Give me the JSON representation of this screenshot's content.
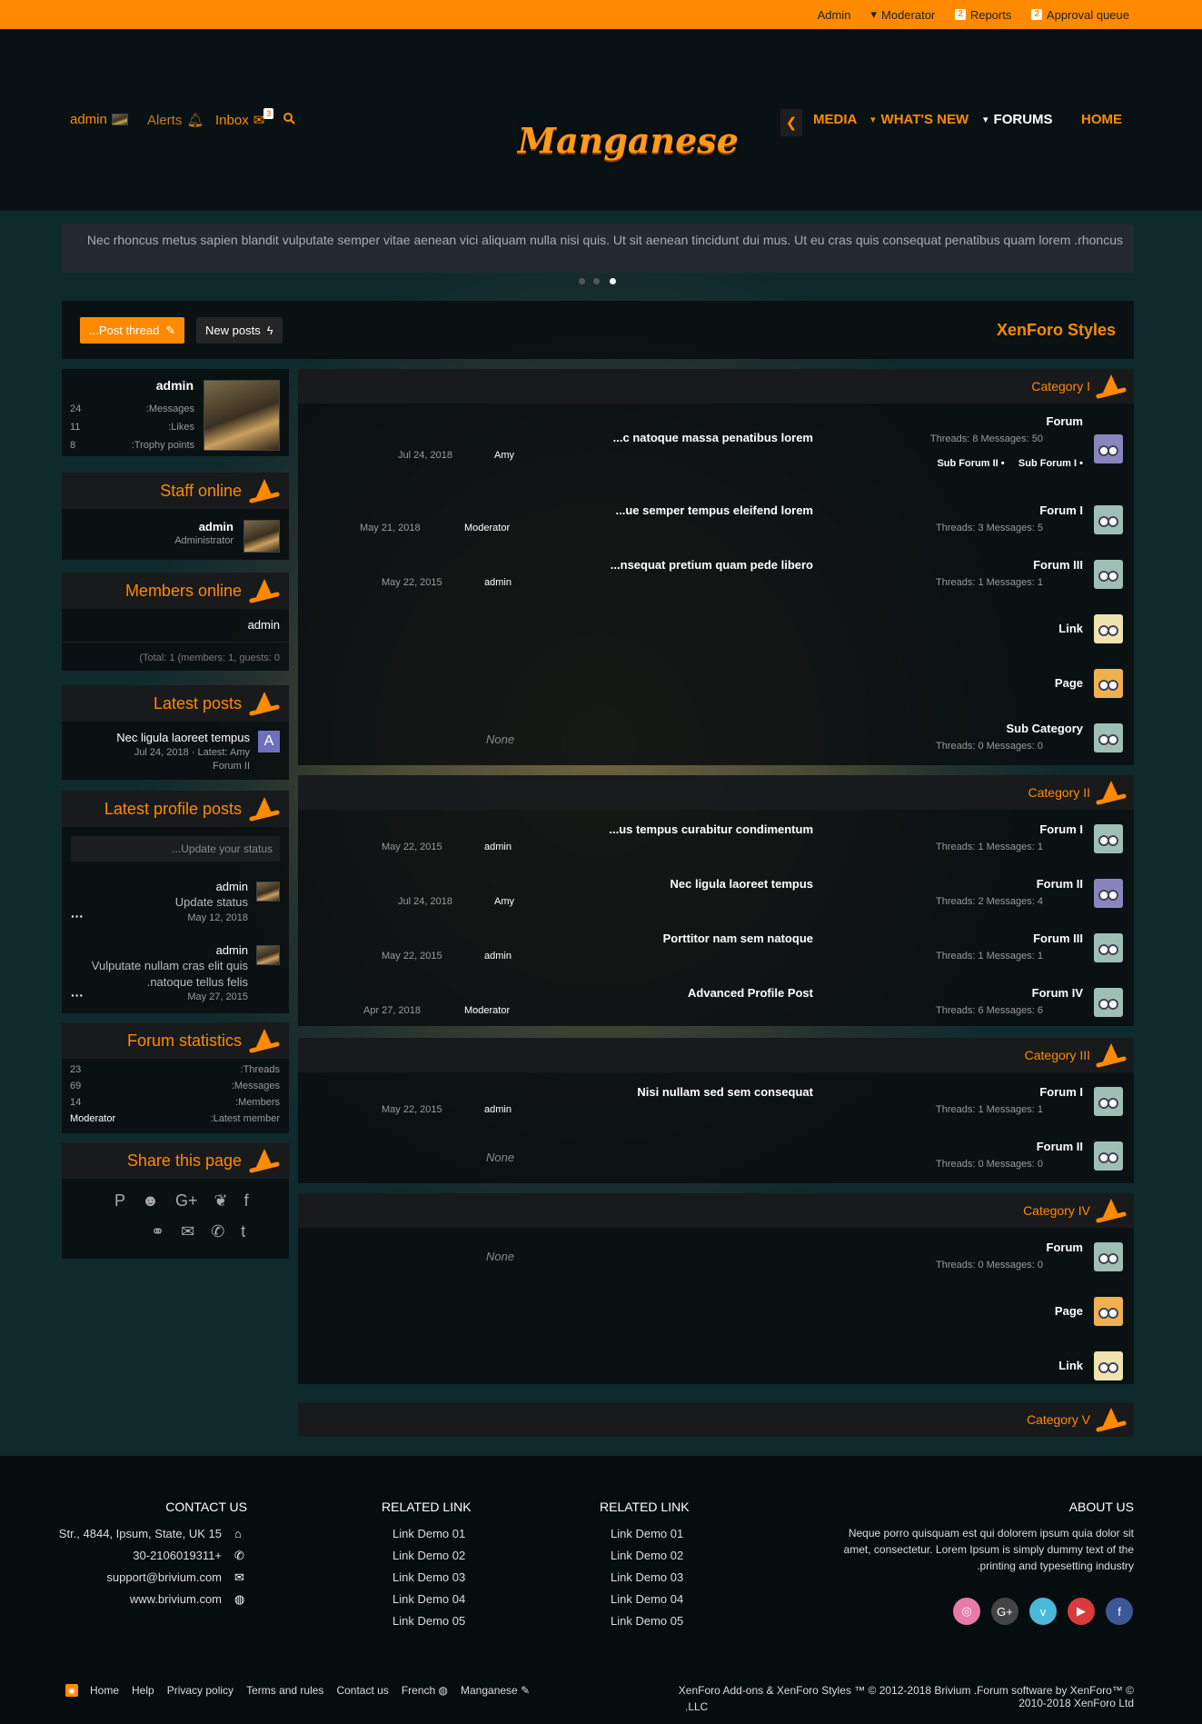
{
  "staff_bar": {
    "admin": "Admin",
    "moderator": "Moderator",
    "reports_count": "2",
    "reports": "Reports",
    "approval_count": "2",
    "approval": "Approval queue"
  },
  "header": {
    "user": "admin",
    "alerts": "Alerts",
    "inbox": "Inbox",
    "inbox_count": "3",
    "logo": "Manganese",
    "nav": {
      "media": "MEDIA",
      "whats_new": "WHAT'S NEW",
      "forums": "FORUMS",
      "home": "HOME"
    }
  },
  "notice": "Nec rhoncus metus sapien blandit vulputate semper vitae aenean vici aliquam nulla nisi quis. Ut sit aenean tincidunt dui mus. Ut eu cras quis consequat penatibus quam lorem .rhoncus",
  "actions": {
    "post_thread": "...Post thread",
    "new_posts": "New posts",
    "site_title": "XenForo Styles"
  },
  "sidebar": {
    "visitor": {
      "name": "admin",
      "stats": [
        {
          "value": "24",
          "label": ":Messages"
        },
        {
          "value": "11",
          "label": ":Likes"
        },
        {
          "value": "8",
          "label": ":Trophy points"
        }
      ]
    },
    "staff_online": {
      "title": "Staff online",
      "name": "admin",
      "role": "Administrator"
    },
    "members_online": {
      "title": "Members online",
      "name": "admin",
      "total": "(Total: 1 (members: 1, guests: 0"
    },
    "latest_posts": {
      "title": "Latest posts",
      "post_title": "Nec ligula laoreet tempus",
      "meta": "Jul 24, 2018 · Latest: Amy",
      "forum": "Forum II",
      "avatar_letter": "A"
    },
    "profile_posts": {
      "title": "Latest profile posts",
      "placeholder": "...Update your status",
      "items": [
        {
          "name": "admin",
          "text": "Update status",
          "date": "May 12, 2018"
        },
        {
          "name": "admin",
          "text": "Vulputate nullam cras elit quis",
          "text2": ".natoque tellus felis",
          "date": "May 27, 2015"
        }
      ]
    },
    "statistics": {
      "title": "Forum statistics",
      "rows": [
        {
          "value": "23",
          "label": ":Threads"
        },
        {
          "value": "69",
          "label": ":Messages"
        },
        {
          "value": "14",
          "label": ":Members"
        },
        {
          "value": "Moderator",
          "label": ":Latest member"
        }
      ]
    },
    "share": {
      "title": "Share this page"
    }
  },
  "categories": [
    {
      "title": "Category I",
      "empty": "None",
      "forums": [
        {
          "name": "Forum",
          "stats": "Threads: 8 Messages: 50",
          "sub1": "Sub Forum II",
          "sub2": "Sub Forum I",
          "latest": "...c natoque massa penatibus lorem",
          "date": "Jul 24, 2018",
          "user": "Amy"
        },
        {
          "name": "Forum I",
          "stats": "Threads: 3 Messages: 5",
          "latest": "...ue semper tempus eleifend lorem",
          "date": "May 21, 2018",
          "user": "Moderator"
        },
        {
          "name": "Forum III",
          "stats": "Threads: 1 Messages: 1",
          "latest": "...nsequat pretium quam pede libero",
          "date": "May 22, 2015",
          "user": "admin"
        },
        {
          "name": "Link"
        },
        {
          "name": "Page"
        },
        {
          "name": "Sub Category",
          "stats": "Threads: 0 Messages: 0"
        }
      ]
    },
    {
      "title": "Category II",
      "forums": [
        {
          "name": "Forum I",
          "stats": "Threads: 1 Messages: 1",
          "latest": "...us tempus curabitur condimentum",
          "date": "May 22, 2015",
          "user": "admin"
        },
        {
          "name": "Forum II",
          "stats": "Threads: 2 Messages: 4",
          "latest": "Nec ligula laoreet tempus",
          "date": "Jul 24, 2018",
          "user": "Amy"
        },
        {
          "name": "Forum III",
          "stats": "Threads: 1 Messages: 1",
          "latest": "Porttitor nam sem natoque",
          "date": "May 22, 2015",
          "user": "admin"
        },
        {
          "name": "Forum IV",
          "stats": "Threads: 6 Messages: 6",
          "latest": "Advanced Profile Post",
          "date": "Apr 27, 2018",
          "user": "Moderator"
        }
      ]
    },
    {
      "title": "Category III",
      "empty": "None",
      "forums": [
        {
          "name": "Forum I",
          "stats": "Threads: 1 Messages: 1",
          "latest": "Nisi nullam sed sem consequat",
          "date": "May 22, 2015",
          "user": "admin"
        },
        {
          "name": "Forum II",
          "stats": "Threads: 0 Messages: 0"
        }
      ]
    },
    {
      "title": "Category IV",
      "empty": "None",
      "forums": [
        {
          "name": "Forum",
          "stats": "Threads: 0 Messages: 0"
        },
        {
          "name": "Page"
        },
        {
          "name": "Link"
        }
      ]
    },
    {
      "title": "Category V"
    }
  ],
  "footer": {
    "contact": {
      "title": "CONTACT US",
      "address": "Str., 4844, Ipsum, State, UK 15",
      "phone": "30-2106019311+",
      "email": "support@brivium.com",
      "web": "www.brivium.com"
    },
    "related1": {
      "title": "RELATED LINK",
      "links": [
        "Link Demo 01",
        "Link Demo 02",
        "Link Demo 03",
        "Link Demo 04",
        "Link Demo 05"
      ]
    },
    "related2": {
      "title": "RELATED LINK",
      "links": [
        "Link Demo 01",
        "Link Demo 02",
        "Link Demo 03",
        "Link Demo 04",
        "Link Demo 05"
      ]
    },
    "about": {
      "title": "ABOUT US",
      "line1": "Neque porro quisquam est qui dolorem ipsum quia dolor sit",
      "line2": "amet, consectetur. Lorem Ipsum is simply dummy text of the",
      "line3": ".printing and typesetting industry"
    },
    "bottom": {
      "home": "Home",
      "help": "Help",
      "privacy": "Privacy policy",
      "terms": "Terms and rules",
      "contact": "Contact us",
      "lang": "French",
      "style": "Manganese",
      "copyright": "XenForo Add-ons & XenForo Styles ™ © 2012-2018 Brivium .Forum software by XenForo™ © 2010-2018 XenForo Ltd",
      "copyright2": ".LLC"
    }
  },
  "colors": {
    "accent": "#ff8a00",
    "panel": "#0a0e10"
  }
}
